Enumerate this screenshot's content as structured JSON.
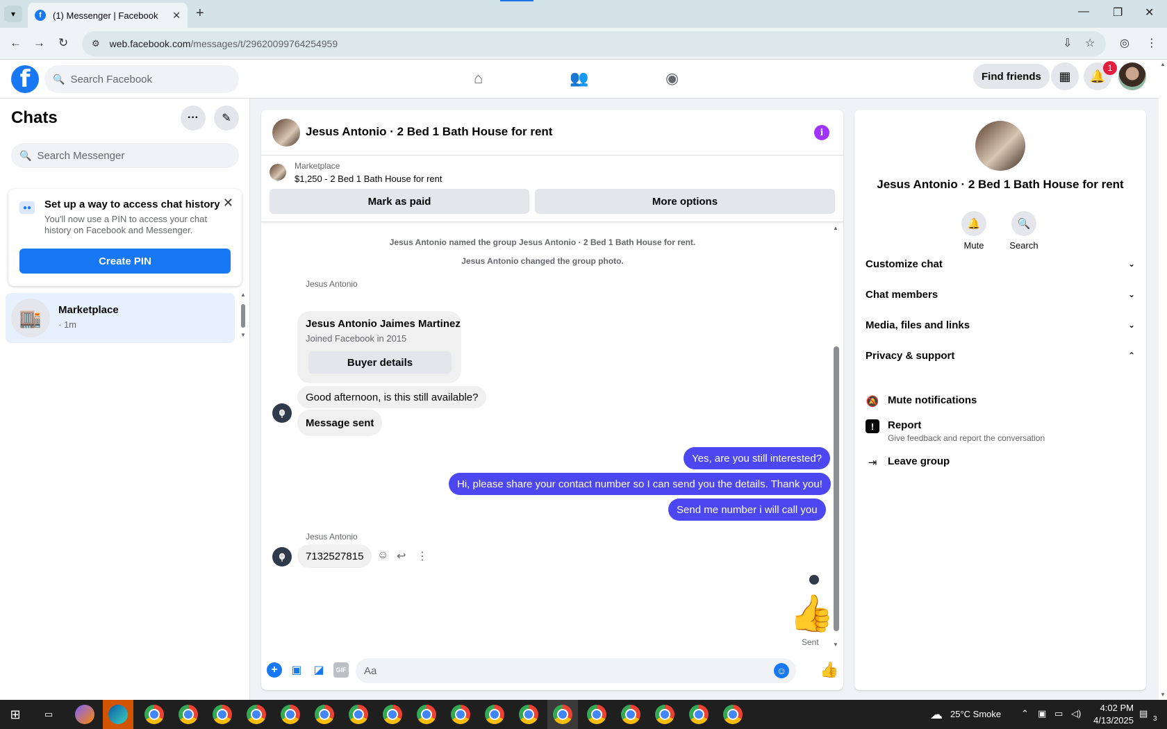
{
  "browser": {
    "tab_title": "(1) Messenger | Facebook",
    "tab_favicon": "f",
    "url_host": "web.facebook.com",
    "url_path": "/messages/t/29620099764254959"
  },
  "fb": {
    "search_placeholder": "Search Facebook",
    "find_friends": "Find friends",
    "notif_count": "1",
    "logo_letter": "f"
  },
  "left": {
    "title": "Chats",
    "search_placeholder": "Search Messenger",
    "pin_card": {
      "title": "Set up a way to access chat history",
      "desc": "You'll now use a PIN to access your chat history on Facebook and Messenger.",
      "button": "Create PIN"
    },
    "chat_item": {
      "name": "Marketplace",
      "time": "· 1m"
    }
  },
  "conv": {
    "title": "Jesus Antonio · 2 Bed 1 Bath House for rent",
    "market_label": "Marketplace",
    "market_price": "$1,250 - 2 Bed 1 Bath House for rent",
    "mark_paid": "Mark as paid",
    "more_options": "More options",
    "sys1": "Jesus Antonio named the group Jesus Antonio · 2 Bed 1 Bath House for rent.",
    "sys2": "Jesus Antonio changed the group photo.",
    "sender1": "Jesus Antonio",
    "buyer_name": "Jesus Antonio Jaimes Martinez",
    "buyer_joined": "Joined Facebook in 2015",
    "buyer_details": "Buyer details",
    "in1": "Good afternoon, is this still available?",
    "in2": "Message sent",
    "out1": "Yes, are you still interested?",
    "out2": "Hi, please share your contact number so I can send you the details. Thank you!",
    "out3": "Send me number i will call you",
    "sender2": "Jesus Antonio",
    "in3": "7132527815",
    "sent_label": "Sent",
    "composer_placeholder": "Aa",
    "gif_label": "GIF"
  },
  "right": {
    "name": "Jesus Antonio · 2 Bed 1 Bath House for rent",
    "mute": "Mute",
    "search": "Search",
    "sections": {
      "customize": "Customize chat",
      "members": "Chat members",
      "media": "Media, files and links",
      "privacy": "Privacy & support"
    },
    "mute_notifications": "Mute notifications",
    "report": "Report",
    "report_sub": "Give feedback and report the conversation",
    "leave": "Leave group"
  },
  "taskbar": {
    "weather": "25°C  Smoke",
    "time": "4:02 PM",
    "date": "4/13/2025",
    "notif": "3"
  },
  "colors": {
    "fb_blue": "#1877f2",
    "outgoing_bubble": "#4c47f0",
    "info_purple": "#a033ff"
  }
}
